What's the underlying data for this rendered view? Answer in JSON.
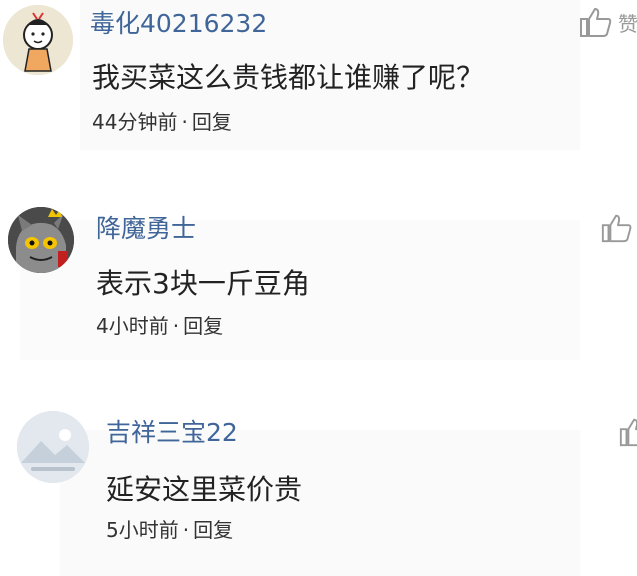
{
  "comments": [
    {
      "username": "毒化40216232",
      "text": "我买菜这么贵钱都让谁赚了呢？",
      "time": "44分钟前",
      "separator": "·",
      "reply": "回复",
      "like_label": "赞"
    },
    {
      "username": "降魔勇士",
      "text": "表示3块一斤豆角",
      "time": "4小时前",
      "separator": "·",
      "reply": "回复"
    },
    {
      "username": "吉祥三宝22",
      "text": "延安这里菜价贵",
      "time": "5小时前",
      "separator": "·",
      "reply": "回复"
    }
  ],
  "colors": {
    "username": "#406599",
    "text": "#222222",
    "icon": "#999999"
  }
}
